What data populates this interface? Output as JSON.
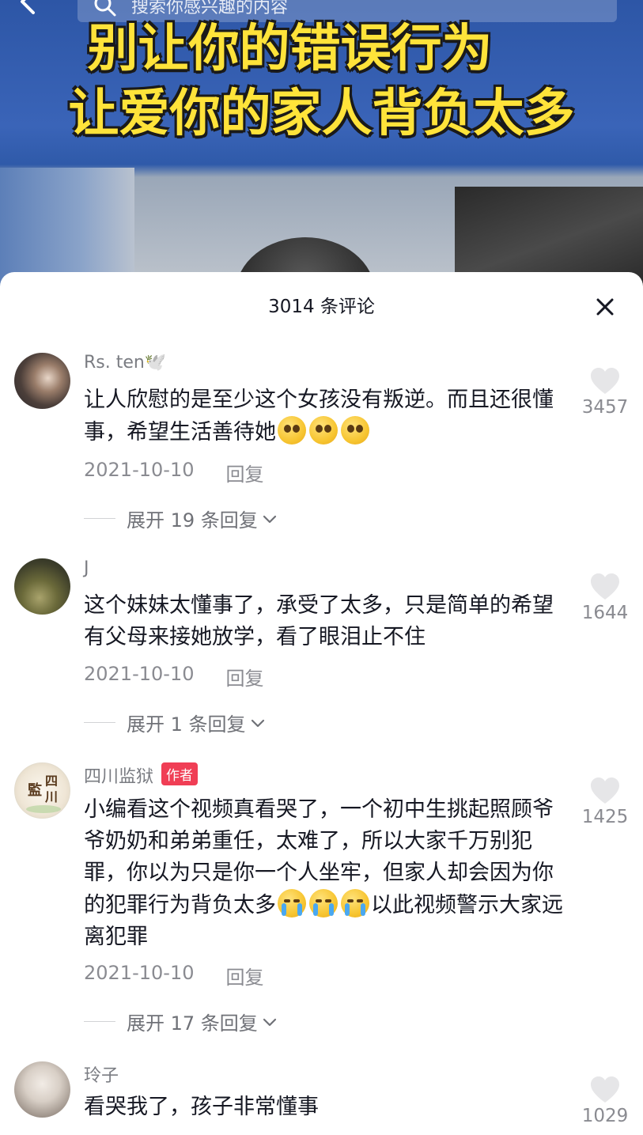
{
  "video": {
    "search_placeholder": "搜索你感兴趣的内容",
    "headline_line1": "别让你的错误行为",
    "headline_line2": "让爱你的家人背负太多"
  },
  "comments_panel": {
    "title": "3014 条评论"
  },
  "comments": [
    {
      "username": "Rs. ten🕊️",
      "text_before_emoji": "让人欣慰的是至少这个女孩没有叛逆。而且还很懂事，希望生活善待她",
      "emoji": "pleading-face x3",
      "date": "2021-10-10",
      "reply_label": "回复",
      "expand_label": "展开 19 条回复",
      "likes": "3457"
    },
    {
      "username": "J",
      "text": "这个妹妹太懂事了，承受了太多，只是简单的希望有父母来接她放学，看了眼泪止不住",
      "date": "2021-10-10",
      "reply_label": "回复",
      "expand_label": "展开 1 条回复",
      "likes": "1644"
    },
    {
      "username": "四川监狱",
      "badge": "作者",
      "text_before_emoji": "小编看这个视频真看哭了，一个初中生挑起照顾爷爷奶奶和弟弟重任，太难了，所以大家千万别犯罪，你以为只是你一个人坐牢，但家人却会因为你的犯罪行为背负太多",
      "emoji": "loudly-crying-face x3",
      "text_after_emoji": "以此视频警示大家远离犯罪",
      "date": "2021-10-10",
      "reply_label": "回复",
      "expand_label": "展开 17 条回复",
      "likes": "1425"
    },
    {
      "username": "玲子",
      "text": "看哭我了，孩子非常懂事",
      "likes": "1029"
    }
  ],
  "colors": {
    "badge": "#f03e55",
    "headline": "#ffe33a",
    "meta_text": "#8a8b91",
    "primary_text": "#161823"
  }
}
